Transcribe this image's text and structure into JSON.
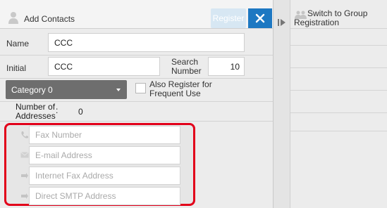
{
  "header": {
    "title": "Add Contacts",
    "register_label": "Register"
  },
  "form": {
    "name_label": "Name",
    "name_value": "CCC",
    "initial_label": "Initial",
    "initial_value": "CCC",
    "search_number_label": "Search Number",
    "search_number_value": "10",
    "category_value": "Category 0",
    "frequent_use_label": "Also Register for Frequent Use",
    "addresses_label": "Number of Addresses",
    "addresses_colon": ":",
    "addresses_count": "0"
  },
  "address_fields": [
    {
      "placeholder": "Fax Number",
      "icon": "phone-icon"
    },
    {
      "placeholder": "E-mail Address",
      "icon": "email-icon"
    },
    {
      "placeholder": "Internet Fax Address",
      "icon": "internet-fax-icon"
    },
    {
      "placeholder": "Direct SMTP Address",
      "icon": "smtp-icon"
    }
  ],
  "side_panel": {
    "switch_label": "Switch to Group Registration"
  },
  "colors": {
    "accent": "#1d78c2",
    "highlight": "#e2001a",
    "register_disabled": "#d7e7f3"
  }
}
